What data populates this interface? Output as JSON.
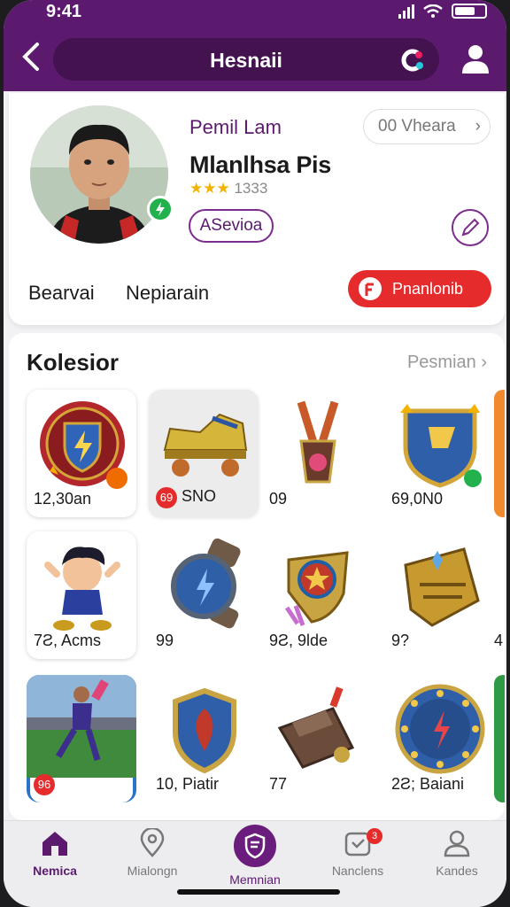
{
  "status": {
    "time": "9:41"
  },
  "header": {
    "title": "Hesnaii"
  },
  "profile": {
    "subtitle": "Pemil Lam",
    "name": "Mlanlhsa Pis",
    "rating_text": "1333",
    "stars": 3,
    "chip_label": "ASevioa",
    "views_label": "00 Vheara",
    "tabs": [
      "Bearvai",
      "Nepiarain"
    ],
    "action_label": "Pnanlonib"
  },
  "collection": {
    "title": "Kolesior",
    "more_label": "Pesmian",
    "items": [
      {
        "caption": "12,30an",
        "icon": "shield-crest-icon"
      },
      {
        "caption": "SNO",
        "icon": "skate-shoe-icon",
        "badge": "69"
      },
      {
        "caption": "09",
        "icon": "medal-icon"
      },
      {
        "caption": "69,0N0",
        "icon": "blue-shield-icon"
      },
      {
        "caption": "",
        "icon": "orange-card-icon"
      },
      {
        "caption": "7Ƨ, Acms",
        "icon": "hero-character-icon"
      },
      {
        "caption": "99",
        "icon": "blue-watch-icon"
      },
      {
        "caption": "9Ƨ, 9lde",
        "icon": "star-badge-icon"
      },
      {
        "caption": "9?",
        "icon": "gold-helmet-icon"
      },
      {
        "caption": "4",
        "icon": "partial-card-icon"
      },
      {
        "caption": "",
        "icon": "soccer-player-icon",
        "badge": "96"
      },
      {
        "caption": "10, Piatir",
        "icon": "crest-shield-icon"
      },
      {
        "caption": "77",
        "icon": "bag-icon"
      },
      {
        "caption": "2Ƨ; Baiani",
        "icon": "star-circle-icon"
      },
      {
        "caption": "",
        "icon": "green-card-icon"
      }
    ]
  },
  "nav": {
    "items": [
      {
        "label": "Nemica"
      },
      {
        "label": "Mialongn"
      },
      {
        "label": "Memnian"
      },
      {
        "label": "Nanclens",
        "badge": "3"
      },
      {
        "label": "Kandes"
      }
    ]
  },
  "colors": {
    "brand": "#5b1a6e",
    "accent": "#e52b2b",
    "online": "#22b14c",
    "star": "#f2b200"
  }
}
